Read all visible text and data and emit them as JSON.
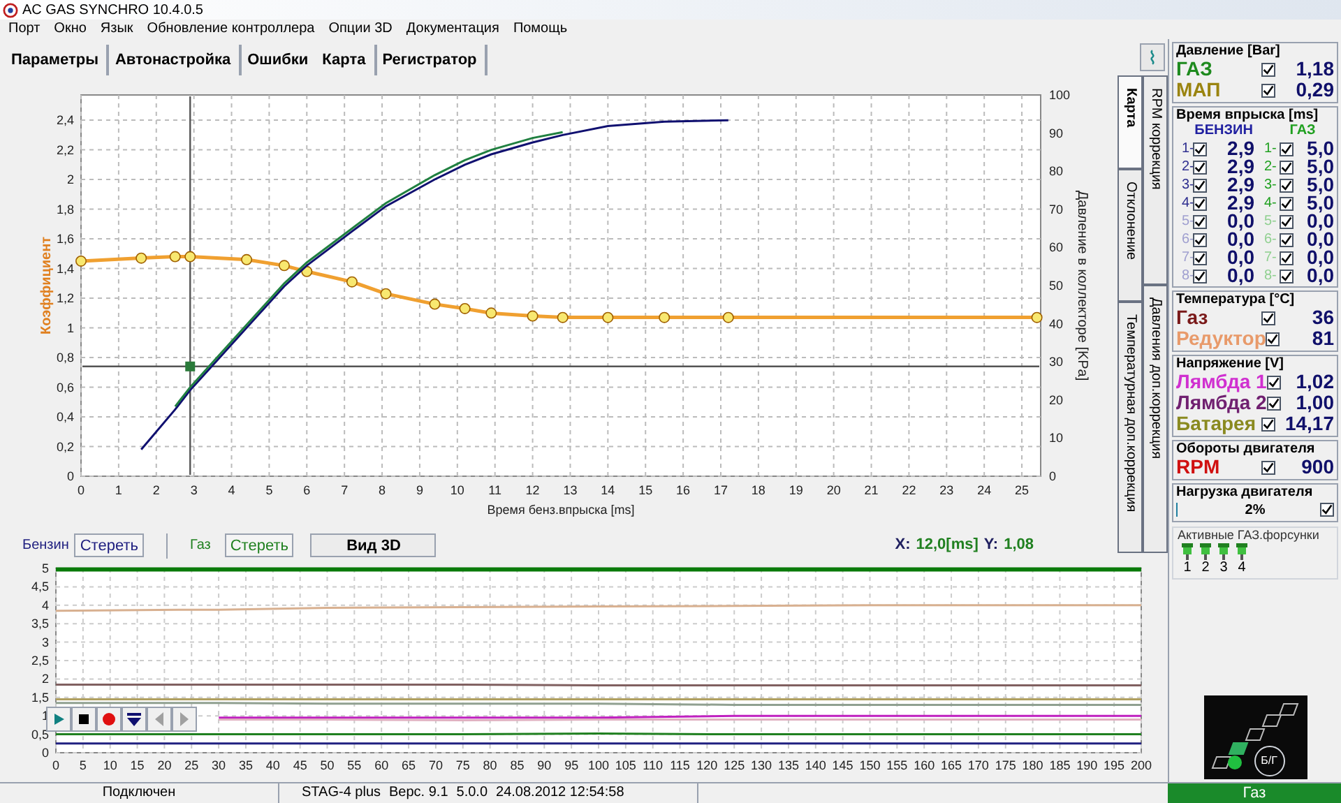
{
  "window": {
    "title": "AC GAS SYNCHRO 10.4.0.5"
  },
  "menu": [
    "Порт",
    "Окно",
    "Язык",
    "Обновление контроллера",
    "Опции 3D",
    "Документация",
    "Помощь"
  ],
  "toolbar": [
    [
      "Параметры"
    ],
    [
      "Автонастройка"
    ],
    [
      "Ошибки",
      "Карта"
    ],
    [
      "Регистратор"
    ]
  ],
  "map_chart": {
    "right_axis_label": "Давление в коллекторе [KPa]",
    "right_yticks": [
      "100",
      "90",
      "80",
      "70",
      "60",
      "50",
      "40",
      "30",
      "20",
      "10",
      "0"
    ],
    "chart_data": {
      "type": "line",
      "xlabel": "Время бенз.впрыска [ms]",
      "ylabel": "Коэффициент",
      "xlim": [
        0,
        25.5
      ],
      "ylim": [
        0,
        2.57
      ],
      "grid": true,
      "x": [
        0,
        1.6,
        2.5,
        2.9,
        4.4,
        5.4,
        6,
        7.2,
        8.1,
        9.4,
        10.2,
        10.9,
        12,
        12.8,
        14,
        15.5,
        17.2,
        25.4
      ],
      "series": [
        {
          "color": "#f0a030",
          "marker": "circle",
          "values": [
            1.45,
            1.47,
            1.48,
            1.48,
            1.46,
            1.42,
            1.38,
            1.31,
            1.23,
            1.16,
            1.13,
            1.1,
            1.08,
            1.07,
            1.07,
            1.07,
            1.07,
            1.07
          ]
        },
        {
          "color": "#101070",
          "values": [
            null,
            0.18,
            0.45,
            0.58,
            1.0,
            1.28,
            1.42,
            1.65,
            1.82,
            2.0,
            2.1,
            2.17,
            2.25,
            2.3,
            2.36,
            2.39,
            2.4,
            null
          ]
        },
        {
          "color": "#208040",
          "values": [
            null,
            null,
            0.47,
            0.6,
            1.02,
            1.3,
            1.44,
            1.67,
            1.84,
            2.03,
            2.13,
            2.2,
            2.28,
            2.32,
            null,
            null,
            null,
            null
          ]
        },
        {
          "color": "#2a7a3a",
          "marker": "square",
          "values": [
            null,
            null,
            null,
            0.74,
            null,
            null,
            null,
            null,
            null,
            null,
            null,
            null,
            null,
            null,
            null,
            null,
            null,
            null
          ]
        }
      ],
      "xticks": [
        0,
        1,
        2,
        3,
        4,
        5,
        6,
        7,
        8,
        9,
        10,
        11,
        12,
        13,
        14,
        15,
        16,
        17,
        18,
        19,
        20,
        21,
        22,
        23,
        24,
        25
      ],
      "yticks": [
        {
          "value": 0,
          "label": "0"
        },
        {
          "value": 0.2,
          "label": "0,2"
        },
        {
          "value": 0.4,
          "label": "0,4"
        },
        {
          "value": 0.6,
          "label": "0,6"
        },
        {
          "value": 0.8,
          "label": "0,8"
        },
        {
          "value": 1,
          "label": "1"
        },
        {
          "value": 1.2,
          "label": "1,2"
        },
        {
          "value": 1.4,
          "label": "1,4"
        },
        {
          "value": 1.6,
          "label": "1,6"
        },
        {
          "value": 1.8,
          "label": "1,8"
        },
        {
          "value": 2,
          "label": "2"
        },
        {
          "value": 2.2,
          "label": "2,2"
        },
        {
          "value": 2.4,
          "label": "2,4"
        }
      ],
      "ref_lines": [
        {
          "axis": "x",
          "value": 2.9
        },
        {
          "axis": "y",
          "value": 0.74
        }
      ]
    }
  },
  "map_controls": {
    "petrol_label": "Бензин",
    "petrol_clear": "Стереть",
    "gas_label": "Газ",
    "gas_clear": "Стереть",
    "view3d": "Вид 3D",
    "x_label": "X:",
    "x_value": "12,0[ms]",
    "y_label": "Y:",
    "y_value": "1,08"
  },
  "side_tabs": [
    [
      {
        "label": "Карта",
        "selected": true
      },
      {
        "label": "Отклонение",
        "selected": false
      },
      {
        "label": "Температурная доп.коррекция",
        "selected": false
      }
    ],
    [
      {
        "label": "RPM коррекция",
        "selected": false
      },
      {
        "label": "Давления доп.коррекция",
        "selected": false
      }
    ]
  ],
  "pressure": {
    "title": "Давление [Bar]",
    "rows": [
      {
        "label": "ГАЗ",
        "color": "#1e8a1e",
        "checked": true,
        "value": "1,18"
      },
      {
        "label": "МАП",
        "color": "#9a8410",
        "checked": true,
        "value": "0,29"
      }
    ]
  },
  "injection": {
    "title": "Время впрыска [ms]",
    "petrol_title": "БЕНЗИН",
    "gas_title": "ГАЗ",
    "rows": [
      {
        "petrol_no": "1-",
        "petrol_checked": true,
        "petrol": "2,9",
        "gas_no": "1-",
        "gas_checked": true,
        "gas": "5,0",
        "active": true
      },
      {
        "petrol_no": "2-",
        "petrol_checked": true,
        "petrol": "2,9",
        "gas_no": "2-",
        "gas_checked": true,
        "gas": "5,0",
        "active": true
      },
      {
        "petrol_no": "3-",
        "petrol_checked": true,
        "petrol": "2,9",
        "gas_no": "3-",
        "gas_checked": true,
        "gas": "5,0",
        "active": true
      },
      {
        "petrol_no": "4-",
        "petrol_checked": true,
        "petrol": "2,9",
        "gas_no": "4-",
        "gas_checked": true,
        "gas": "5,0",
        "active": true
      },
      {
        "petrol_no": "5-",
        "petrol_checked": true,
        "petrol": "0,0",
        "gas_no": "5-",
        "gas_checked": true,
        "gas": "0,0",
        "active": false
      },
      {
        "petrol_no": "6-",
        "petrol_checked": true,
        "petrol": "0,0",
        "gas_no": "6-",
        "gas_checked": true,
        "gas": "0,0",
        "active": false
      },
      {
        "petrol_no": "7-",
        "petrol_checked": true,
        "petrol": "0,0",
        "gas_no": "7-",
        "gas_checked": true,
        "gas": "0,0",
        "active": false
      },
      {
        "petrol_no": "8-",
        "petrol_checked": true,
        "petrol": "0,0",
        "gas_no": "8-",
        "gas_checked": true,
        "gas": "0,0",
        "active": false
      }
    ]
  },
  "temperature": {
    "title": "Температура [°C]",
    "rows": [
      {
        "label": "Газ",
        "color": "#7a1a1a",
        "checked": true,
        "value": "36"
      },
      {
        "label": "Редуктор",
        "color": "#e89a6a",
        "checked": true,
        "value": "81"
      }
    ]
  },
  "voltage": {
    "title": "Напряжение [V]",
    "rows": [
      {
        "label": "Лямбда 1",
        "color": "#d030d0",
        "checked": true,
        "value": "1,02"
      },
      {
        "label": "Лямбда 2",
        "color": "#702070",
        "checked": true,
        "value": "1,00"
      },
      {
        "label": "Батарея",
        "color": "#8a8a20",
        "checked": true,
        "value": "14,17"
      }
    ]
  },
  "rpm": {
    "title": "Обороты двигателя",
    "rows": [
      {
        "label": "RPM",
        "color": "#d01010",
        "checked": true,
        "value": "900"
      }
    ]
  },
  "load": {
    "title": "Нагрузка двигателя",
    "level": 0.02,
    "value": "2%",
    "checked": true
  },
  "injectors": {
    "title": "Активные ГАЗ.форсунки",
    "items": [
      {
        "label": "1",
        "active": true
      },
      {
        "label": "2",
        "active": true
      },
      {
        "label": "3",
        "active": true
      },
      {
        "label": "4",
        "active": true
      }
    ]
  },
  "logger_chart": {
    "chart_data": {
      "type": "line",
      "xlim": [
        0,
        200
      ],
      "ylim": [
        0,
        5
      ],
      "grid": true,
      "x": [
        0,
        25,
        30,
        50,
        75,
        100,
        125,
        150,
        175,
        200
      ],
      "series": [
        {
          "color": "#0a7a0a",
          "values": [
            4.97,
            4.97,
            4.97,
            4.97,
            4.97,
            4.97,
            4.97,
            4.97,
            4.97,
            4.97
          ]
        },
        {
          "color": "#d8b090",
          "values": [
            3.85,
            3.88,
            3.88,
            3.93,
            3.95,
            3.97,
            3.98,
            4.0,
            4.0,
            4.0
          ]
        },
        {
          "color": "#806060",
          "values": [
            1.85,
            1.85,
            1.85,
            1.85,
            1.85,
            1.83,
            1.83,
            1.83,
            1.83,
            1.83
          ]
        },
        {
          "color": "#b0a060",
          "values": [
            1.45,
            1.45,
            1.45,
            1.45,
            1.45,
            1.45,
            1.45,
            1.45,
            1.45,
            1.45
          ]
        },
        {
          "color": "#90a090",
          "values": [
            1.35,
            1.35,
            1.35,
            1.33,
            1.33,
            1.33,
            1.3,
            1.3,
            1.3,
            1.3
          ]
        },
        {
          "color": "#c020c0",
          "values": [
            null,
            null,
            0.95,
            0.95,
            0.95,
            0.95,
            1.0,
            1.0,
            1.0,
            1.0
          ]
        },
        {
          "color": "#e0b0c0",
          "values": [
            null,
            null,
            0.9,
            0.9,
            0.88,
            0.9,
            0.9,
            0.9,
            0.9,
            0.9
          ]
        },
        {
          "color": "#208020",
          "values": [
            0.5,
            0.5,
            0.5,
            0.5,
            0.5,
            0.52,
            0.5,
            0.5,
            0.5,
            0.5
          ]
        },
        {
          "color": "#202080",
          "values": [
            0.25,
            0.25,
            0.25,
            0.25,
            0.25,
            0.25,
            0.25,
            0.25,
            0.25,
            0.25
          ]
        }
      ],
      "xticks": [
        0,
        5,
        10,
        15,
        20,
        25,
        30,
        35,
        40,
        45,
        50,
        55,
        60,
        65,
        70,
        75,
        80,
        85,
        90,
        95,
        100,
        105,
        110,
        115,
        120,
        125,
        130,
        135,
        140,
        145,
        150,
        155,
        160,
        165,
        170,
        175,
        180,
        185,
        190,
        195,
        200
      ],
      "yticks": [
        {
          "value": 0,
          "label": "0"
        },
        {
          "value": 0.5,
          "label": "0,5"
        },
        {
          "value": 1,
          "label": "1"
        },
        {
          "value": 1.5,
          "label": "1,5"
        },
        {
          "value": 2,
          "label": "2"
        },
        {
          "value": 2.5,
          "label": "2,5"
        },
        {
          "value": 3,
          "label": "3"
        },
        {
          "value": 3.5,
          "label": "3,5"
        },
        {
          "value": 4,
          "label": "4"
        },
        {
          "value": 4.5,
          "label": "4,5"
        },
        {
          "value": 5,
          "label": "5"
        }
      ]
    }
  },
  "player_buttons": [
    {
      "kind": "play",
      "disabled": false
    },
    {
      "kind": "stop",
      "disabled": false
    },
    {
      "kind": "record",
      "disabled": false
    },
    {
      "kind": "down",
      "disabled": false
    },
    {
      "kind": "prev",
      "disabled": true
    },
    {
      "kind": "next",
      "disabled": true
    }
  ],
  "indicator": {
    "segments": [
      {
        "on": false
      },
      {
        "on": true
      },
      {
        "on": false
      },
      {
        "on": false
      },
      {
        "on": false
      }
    ],
    "led_on": true,
    "switch_label": "Б/Г"
  },
  "status_bar": {
    "connection": "Подключен",
    "device": "STAG-4 plus",
    "version": "Верс. 9.1",
    "firmware": "5.0.0",
    "datetime": "24.08.2012 12:54:58",
    "mode": "Газ"
  }
}
